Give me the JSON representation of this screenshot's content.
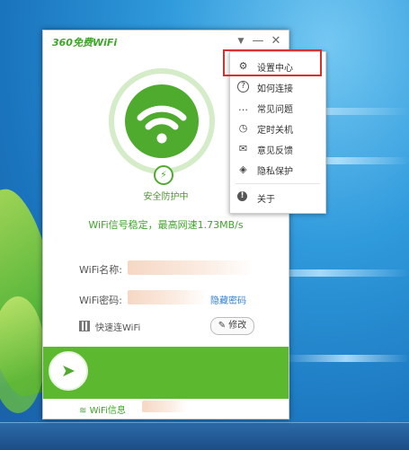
{
  "app": {
    "logo": "360免费WiFi",
    "status_label": "安全防护中",
    "status_message": "WiFi信号稳定，最高网速1.73MB/s",
    "wifi_name_label": "WiFi名称:",
    "wifi_password_label": "WiFi密码:",
    "hide_password_link": "隐藏密码",
    "quick_connect_label": "快速连WiFi",
    "edit_button": "修改",
    "wifi_info_tab": "WiFi信息"
  },
  "window_controls": {
    "dropdown": "▼",
    "minimize": "—",
    "close": "✕"
  },
  "menu": {
    "items": [
      {
        "label": "设置中心",
        "icon": "gear-icon",
        "glyph": "⚙"
      },
      {
        "label": "如何连接",
        "icon": "question-icon",
        "glyph": "?"
      },
      {
        "label": "常见问题",
        "icon": "chat-icon",
        "glyph": "…"
      },
      {
        "label": "定时关机",
        "icon": "clock-icon",
        "glyph": "◷"
      },
      {
        "label": "意见反馈",
        "icon": "feedback-icon",
        "glyph": "✉"
      },
      {
        "label": "隐私保护",
        "icon": "shield-icon",
        "glyph": "◈"
      },
      {
        "label": "关于",
        "icon": "info-icon",
        "glyph": "!"
      }
    ]
  },
  "colors": {
    "brand_green": "#4eab2e",
    "highlight_red": "#d8312d",
    "link_blue": "#2f7fd4"
  }
}
